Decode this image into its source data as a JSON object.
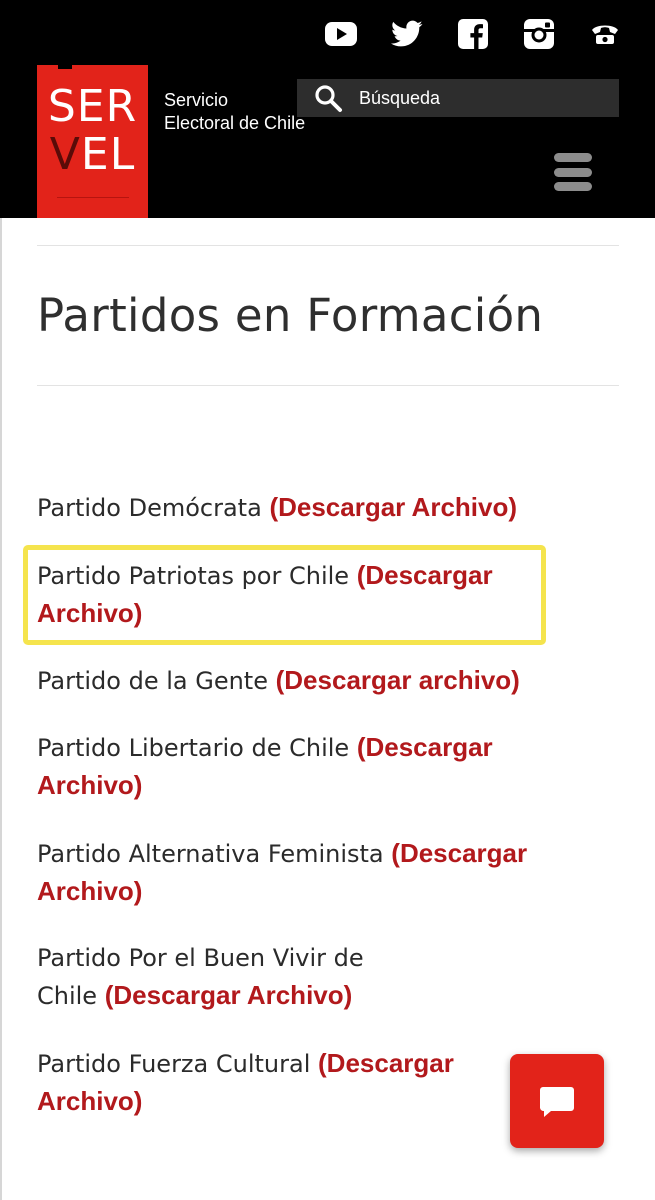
{
  "header": {
    "logo": {
      "line1": "SER",
      "line2_v": "V",
      "line2_rest": "EL"
    },
    "tagline_line1": "Servicio",
    "tagline_line2": "Electoral de Chile",
    "search": {
      "placeholder": "Búsqueda"
    },
    "social_icons": [
      "youtube-icon",
      "twitter-icon",
      "facebook-icon",
      "instagram-icon",
      "phone-icon"
    ]
  },
  "main": {
    "title": "Partidos en Formación",
    "parties": [
      {
        "name": "Partido Demócrata",
        "link": "(Descargar Archivo)"
      },
      {
        "name": "Partido Patriotas por Chile",
        "link": "(Descargar Archivo)"
      },
      {
        "name": "Partido de la Gente",
        "link": "(Descargar archivo)"
      },
      {
        "name": "Partido Libertario de Chile",
        "link": "(Descargar Archivo)"
      },
      {
        "name": "Partido Alternativa Feminista",
        "link": "(Descargar Archivo)"
      },
      {
        "name": "Partido Por el Buen Vivir de Chile",
        "link": "(Descargar Archivo)"
      },
      {
        "name": "Partido Fuerza Cultural",
        "link": "(Descargar Archivo)"
      }
    ]
  },
  "colors": {
    "brand_red": "#e2231a",
    "link_red": "#b2191c",
    "highlight_yellow": "#f5e44d",
    "header_bg": "#000000"
  }
}
